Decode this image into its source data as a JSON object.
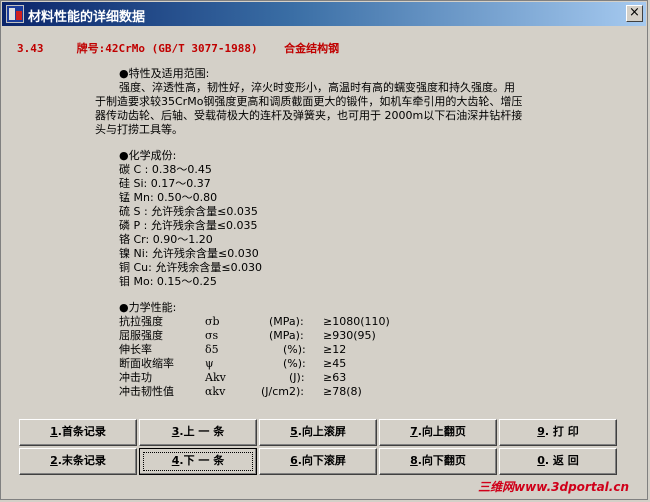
{
  "window": {
    "title": "材料性能的详细数据",
    "close_symbol": "×"
  },
  "headline": {
    "index": "3.43",
    "grade": "牌号:42CrMo (GB/T 3077-1988)",
    "category": "合金结构钢"
  },
  "usage": {
    "heading": "●特性及适用范围:",
    "lines": [
      "强度、淬透性高，韧性好，淬火时变形小，高温时有高的蠕变强度和持久强度。用",
      "于制造要求较35CrMo钢强度更高和调质截面更大的锻件，如机车牵引用的大齿轮、增压",
      "器传动齿轮、后轴、受载荷极大的连杆及弹簧夹，也可用于 2000m以下石油深井钻杆接",
      "头与打捞工具等。"
    ]
  },
  "chemistry": {
    "heading": "●化学成份:",
    "rows": [
      "碳 C : 0.38～0.45",
      "硅 Si: 0.17～0.37",
      "锰 Mn: 0.50～0.80",
      "硫 S : 允许残余含量≤0.035",
      "磷 P : 允许残余含量≤0.035",
      "铬 Cr: 0.90～1.20",
      "镍 Ni: 允许残余含量≤0.030",
      "铜 Cu: 允许残余含量≤0.030",
      "钼 Mo: 0.15～0.25"
    ]
  },
  "mechanics": {
    "heading": "●力学性能:",
    "rows": [
      {
        "name": "抗拉强度",
        "symbol": "σb",
        "unit": "(MPa):",
        "value": "≥1080(110)"
      },
      {
        "name": "屈服强度",
        "symbol": "σs",
        "unit": "(MPa):",
        "value": "≥930(95)"
      },
      {
        "name": "伸长率",
        "symbol": "δ5",
        "unit": "(%):",
        "value": "≥12"
      },
      {
        "name": "断面收缩率",
        "symbol": "ψ",
        "unit": "(%):",
        "value": "≥45"
      },
      {
        "name": "冲击功",
        "symbol": "Akv",
        "unit": "(J):",
        "value": "≥63"
      },
      {
        "name": "冲击韧性值",
        "symbol": "αkv",
        "unit": "(J/cm2):",
        "value": "≥78(8)"
      }
    ]
  },
  "buttons": {
    "first": {
      "key": "1",
      "label": ".首条记录"
    },
    "prev": {
      "key": "3",
      "label": ".上 一 条"
    },
    "scroll_up": {
      "key": "5",
      "label": ".向上滚屏"
    },
    "page_up": {
      "key": "7",
      "label": ".向上翻页"
    },
    "print": {
      "key": "9",
      "label": ". 打  印"
    },
    "last": {
      "key": "2",
      "label": ".末条记录"
    },
    "next": {
      "key": "4",
      "label": ".下 一 条"
    },
    "scroll_down": {
      "key": "6",
      "label": ".向下滚屏"
    },
    "page_down": {
      "key": "8",
      "label": ".向下翻页"
    },
    "back": {
      "key": "0",
      "label": ". 返  回"
    }
  },
  "watermark": "三维网www.3dportal.cn",
  "colors": {
    "titlebar_start": "#0a246a",
    "titlebar_end": "#a6caf0",
    "headline": "#c00000",
    "face": "#d4d0c8"
  }
}
